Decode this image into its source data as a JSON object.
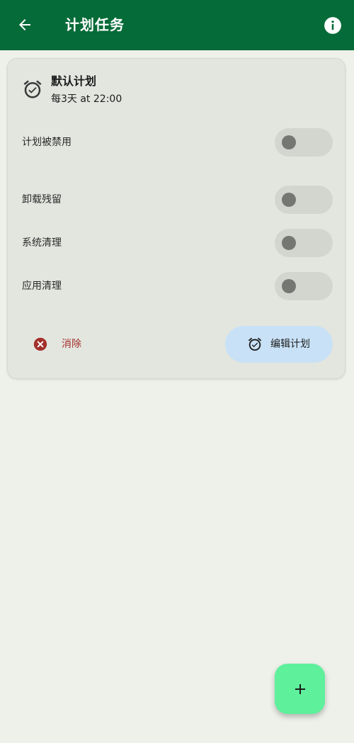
{
  "app_bar": {
    "title": "计划任务",
    "back_icon": "arrow-left-icon",
    "info_icon": "info-icon",
    "background_color": "#056b38"
  },
  "plan_card": {
    "name": "默认计划",
    "schedule": "每3天 at 22:00",
    "icon": "alarm-check-icon",
    "settings": [
      {
        "label": "计划被禁用",
        "enabled": false
      },
      {
        "label": "卸载残留",
        "enabled": false
      },
      {
        "label": "系统清理",
        "enabled": false
      },
      {
        "label": "应用清理",
        "enabled": false
      }
    ],
    "actions": {
      "delete_label": "消除",
      "delete_icon": "close-circle-icon",
      "delete_color": "#a3302b",
      "edit_label": "编辑计划",
      "edit_icon": "alarm-check-icon",
      "edit_color": "#c8e1f6"
    }
  },
  "fab": {
    "icon": "plus-icon",
    "color": "#5ef09b"
  }
}
